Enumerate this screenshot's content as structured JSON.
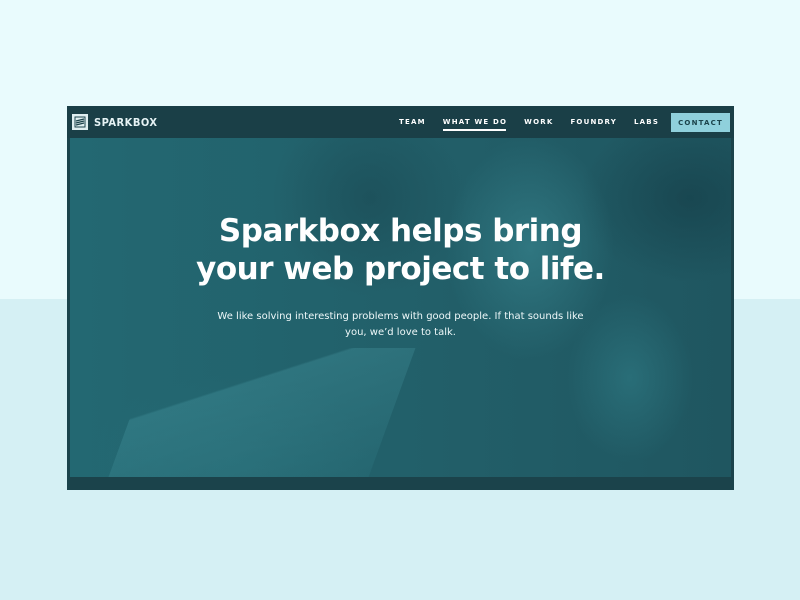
{
  "brand": {
    "name": "SPARKBOX",
    "logo_icon": "sparkbox-logo-icon"
  },
  "nav": {
    "items": [
      {
        "label": "TEAM",
        "active": false
      },
      {
        "label": "WHAT WE DO",
        "active": true
      },
      {
        "label": "WORK",
        "active": false
      },
      {
        "label": "FOUNDRY",
        "active": false
      },
      {
        "label": "LABS",
        "active": false
      }
    ],
    "contact_label": "CONTACT"
  },
  "hero": {
    "headline_line1": "Sparkbox helps bring",
    "headline_line2": "your web project to life.",
    "subtext_line1": "We like solving interesting problems with good people. If that sounds like",
    "subtext_line2": "you, we’d love to talk.",
    "scroll_icon": "chevron-down-icon"
  },
  "colors": {
    "page_bg_top": "#e9fbfd",
    "page_bg_bottom": "#d5f0f4",
    "navbar_bg": "#1a3f47",
    "hero_tint": "#236872",
    "contact_bg": "#8fd0dc",
    "text_light": "#ffffff"
  }
}
